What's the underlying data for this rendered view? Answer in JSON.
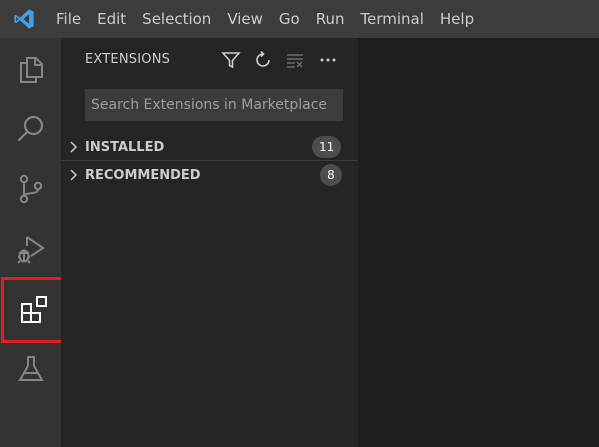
{
  "titlebar": {
    "app_icon": "vscode-logo-icon",
    "menu": [
      "File",
      "Edit",
      "Selection",
      "View",
      "Go",
      "Run",
      "Terminal",
      "Help"
    ]
  },
  "activity_bar": {
    "items": [
      {
        "icon": "explorer-files-icon"
      },
      {
        "icon": "search-icon"
      },
      {
        "icon": "source-control-icon"
      },
      {
        "icon": "run-debug-icon"
      },
      {
        "icon": "extensions-icon",
        "selected": true
      },
      {
        "icon": "testing-flask-icon"
      }
    ],
    "highlight_color": "#e31b23"
  },
  "sidebar": {
    "title": "EXTENSIONS",
    "actions": [
      {
        "icon": "filter-icon"
      },
      {
        "icon": "refresh-icon"
      },
      {
        "icon": "clear-results-icon"
      },
      {
        "icon": "more-actions-icon"
      }
    ],
    "search": {
      "placeholder": "Search Extensions in Marketplace",
      "value": ""
    },
    "sections": [
      {
        "label": "INSTALLED",
        "count": "11"
      },
      {
        "label": "RECOMMENDED",
        "count": "8"
      }
    ]
  },
  "colors": {
    "titlebar": "#3c3c3c",
    "activity_bar": "#333333",
    "sidebar": "#252526",
    "editor": "#1e1e1e",
    "accent": "#007acc"
  }
}
